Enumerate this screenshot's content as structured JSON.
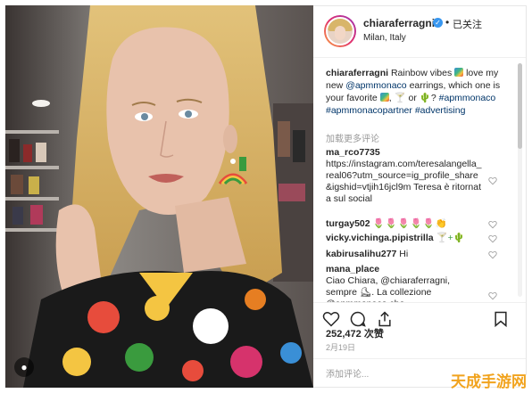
{
  "post": {
    "username": "chiaraferragni",
    "dot": "•",
    "follow_label": "已关注",
    "location": "Milan, Italy"
  },
  "caption": {
    "username": "chiaraferragni",
    "text_1": "Rainbow vibes",
    "text_2": "love my new",
    "mention": "@apmmonaco",
    "text_3": "earrings, which one is your favorite",
    "text_4": "or",
    "text_5": "?",
    "hashtag_1": "#apmmonaco",
    "hashtag_2": "#apmmonacopartner",
    "hashtag_3": "#advertising"
  },
  "load_more": "加载更多评论",
  "comments": [
    {
      "username": "ma_rco7735",
      "text": "https://instagram.com/teresalangella_real06?utm_source=ig_profile_share&igshid=vtjih16jcl9m Teresa è ritornata sul social"
    },
    {
      "username": "turgay502",
      "text": "🌷🌷🌷🌷🌷"
    },
    {
      "username": "vicky.vichinga.pipistrilla",
      "text": "🍸+🌵"
    },
    {
      "username": "kabirusalihu277",
      "text": "Hi"
    },
    {
      "username": "mana_place",
      "text": "Ciao Chiara, @chiaraferragni, sempre ⛸. La collezione @apmmonaco che"
    }
  ],
  "likes": "252,472 次赞",
  "date": "2月19日",
  "add_comment_placeholder": "添加评论...",
  "site_watermark": "天成手游网",
  "icons": {
    "verified": "verified-badge-icon",
    "like": "heart-outline-icon",
    "comment": "speech-bubble-icon",
    "share": "share-upload-icon",
    "save": "bookmark-icon"
  },
  "colors": {
    "link": "#003569",
    "verified": "#3897f0",
    "muted": "#999999",
    "text": "#262626"
  }
}
